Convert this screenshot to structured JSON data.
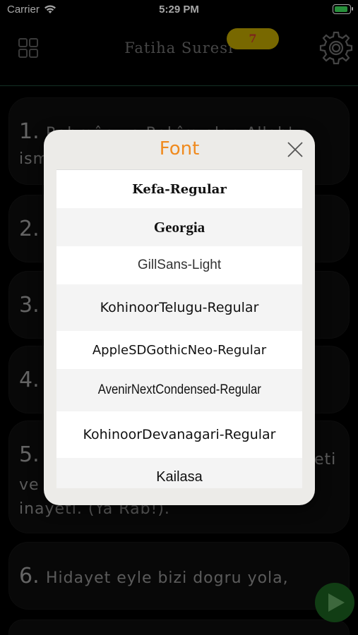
{
  "status_bar": {
    "carrier": "Carrier",
    "time": "5:29 PM"
  },
  "nav": {
    "title": "Fatiha  Suresi",
    "badge": "7",
    "menu_icon": "grid-icon",
    "settings_icon": "gear-icon"
  },
  "verses": [
    {
      "num": "1.",
      "line1": "Rahmân ve Rahîm olan Allah'ın",
      "line2": "ismiyle"
    },
    {
      "num": "2.",
      "line1": ""
    },
    {
      "num": "3.",
      "line1": ""
    },
    {
      "num": "4.",
      "line1": ""
    },
    {
      "num": "5.",
      "line1": "",
      "line1_end": "eti",
      "line2": "ve",
      "line3": "inayeti. (Ya Rab!)."
    },
    {
      "num": "6.",
      "line1": "Hidayet eyle bizi dogru yola,"
    }
  ],
  "play_icon": "play-icon",
  "modal": {
    "title": "Font",
    "close_icon": "close-icon",
    "fonts": [
      "Kefa-Regular",
      "Georgia",
      "GillSans-Light",
      "KohinoorTelugu-Regular",
      "AppleSDGothicNeo-Regular",
      "AvenirNextCondensed-Regular",
      "KohinoorDevanagari-Regular",
      "Kailasa"
    ]
  },
  "colors": {
    "accent": "#f08a1e",
    "badge_bg": "#b8a000",
    "badge_text": "#c0392b",
    "play_bg": "#1b5e20"
  }
}
